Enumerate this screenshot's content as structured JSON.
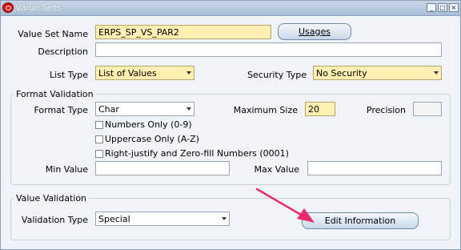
{
  "window": {
    "title": "Value Sets"
  },
  "form": {
    "value_set_name": {
      "label": "Value Set Name",
      "value": "ERPS_SP_VS_PAR2"
    },
    "usages_button": {
      "label": "Usages"
    },
    "description": {
      "label": "Description",
      "value": ""
    },
    "list_type": {
      "label": "List Type",
      "value": "List of Values"
    },
    "security_type": {
      "label": "Security Type",
      "value": "No Security"
    }
  },
  "format_validation": {
    "legend": "Format Validation",
    "format_type": {
      "label": "Format Type",
      "value": "Char"
    },
    "maximum_size": {
      "label": "Maximum Size",
      "value": "20"
    },
    "precision": {
      "label": "Precision",
      "value": ""
    },
    "numbers_only": {
      "label": "Numbers Only (0-9)",
      "checked": false
    },
    "uppercase_only": {
      "label": "Uppercase Only (A-Z)",
      "checked": false
    },
    "right_justify": {
      "label": "Right-justify and Zero-fill Numbers (0001)",
      "checked": false
    },
    "min_value": {
      "label": "Min Value",
      "value": ""
    },
    "max_value": {
      "label": "Max Value",
      "value": ""
    }
  },
  "value_validation": {
    "legend": "Value Validation",
    "validation_type": {
      "label": "Validation Type",
      "value": "Special"
    },
    "edit_information_button": {
      "label": "Edit Information"
    }
  },
  "colors": {
    "required_field": "#ffefb0",
    "annotation_arrow": "#ee2a6e"
  }
}
